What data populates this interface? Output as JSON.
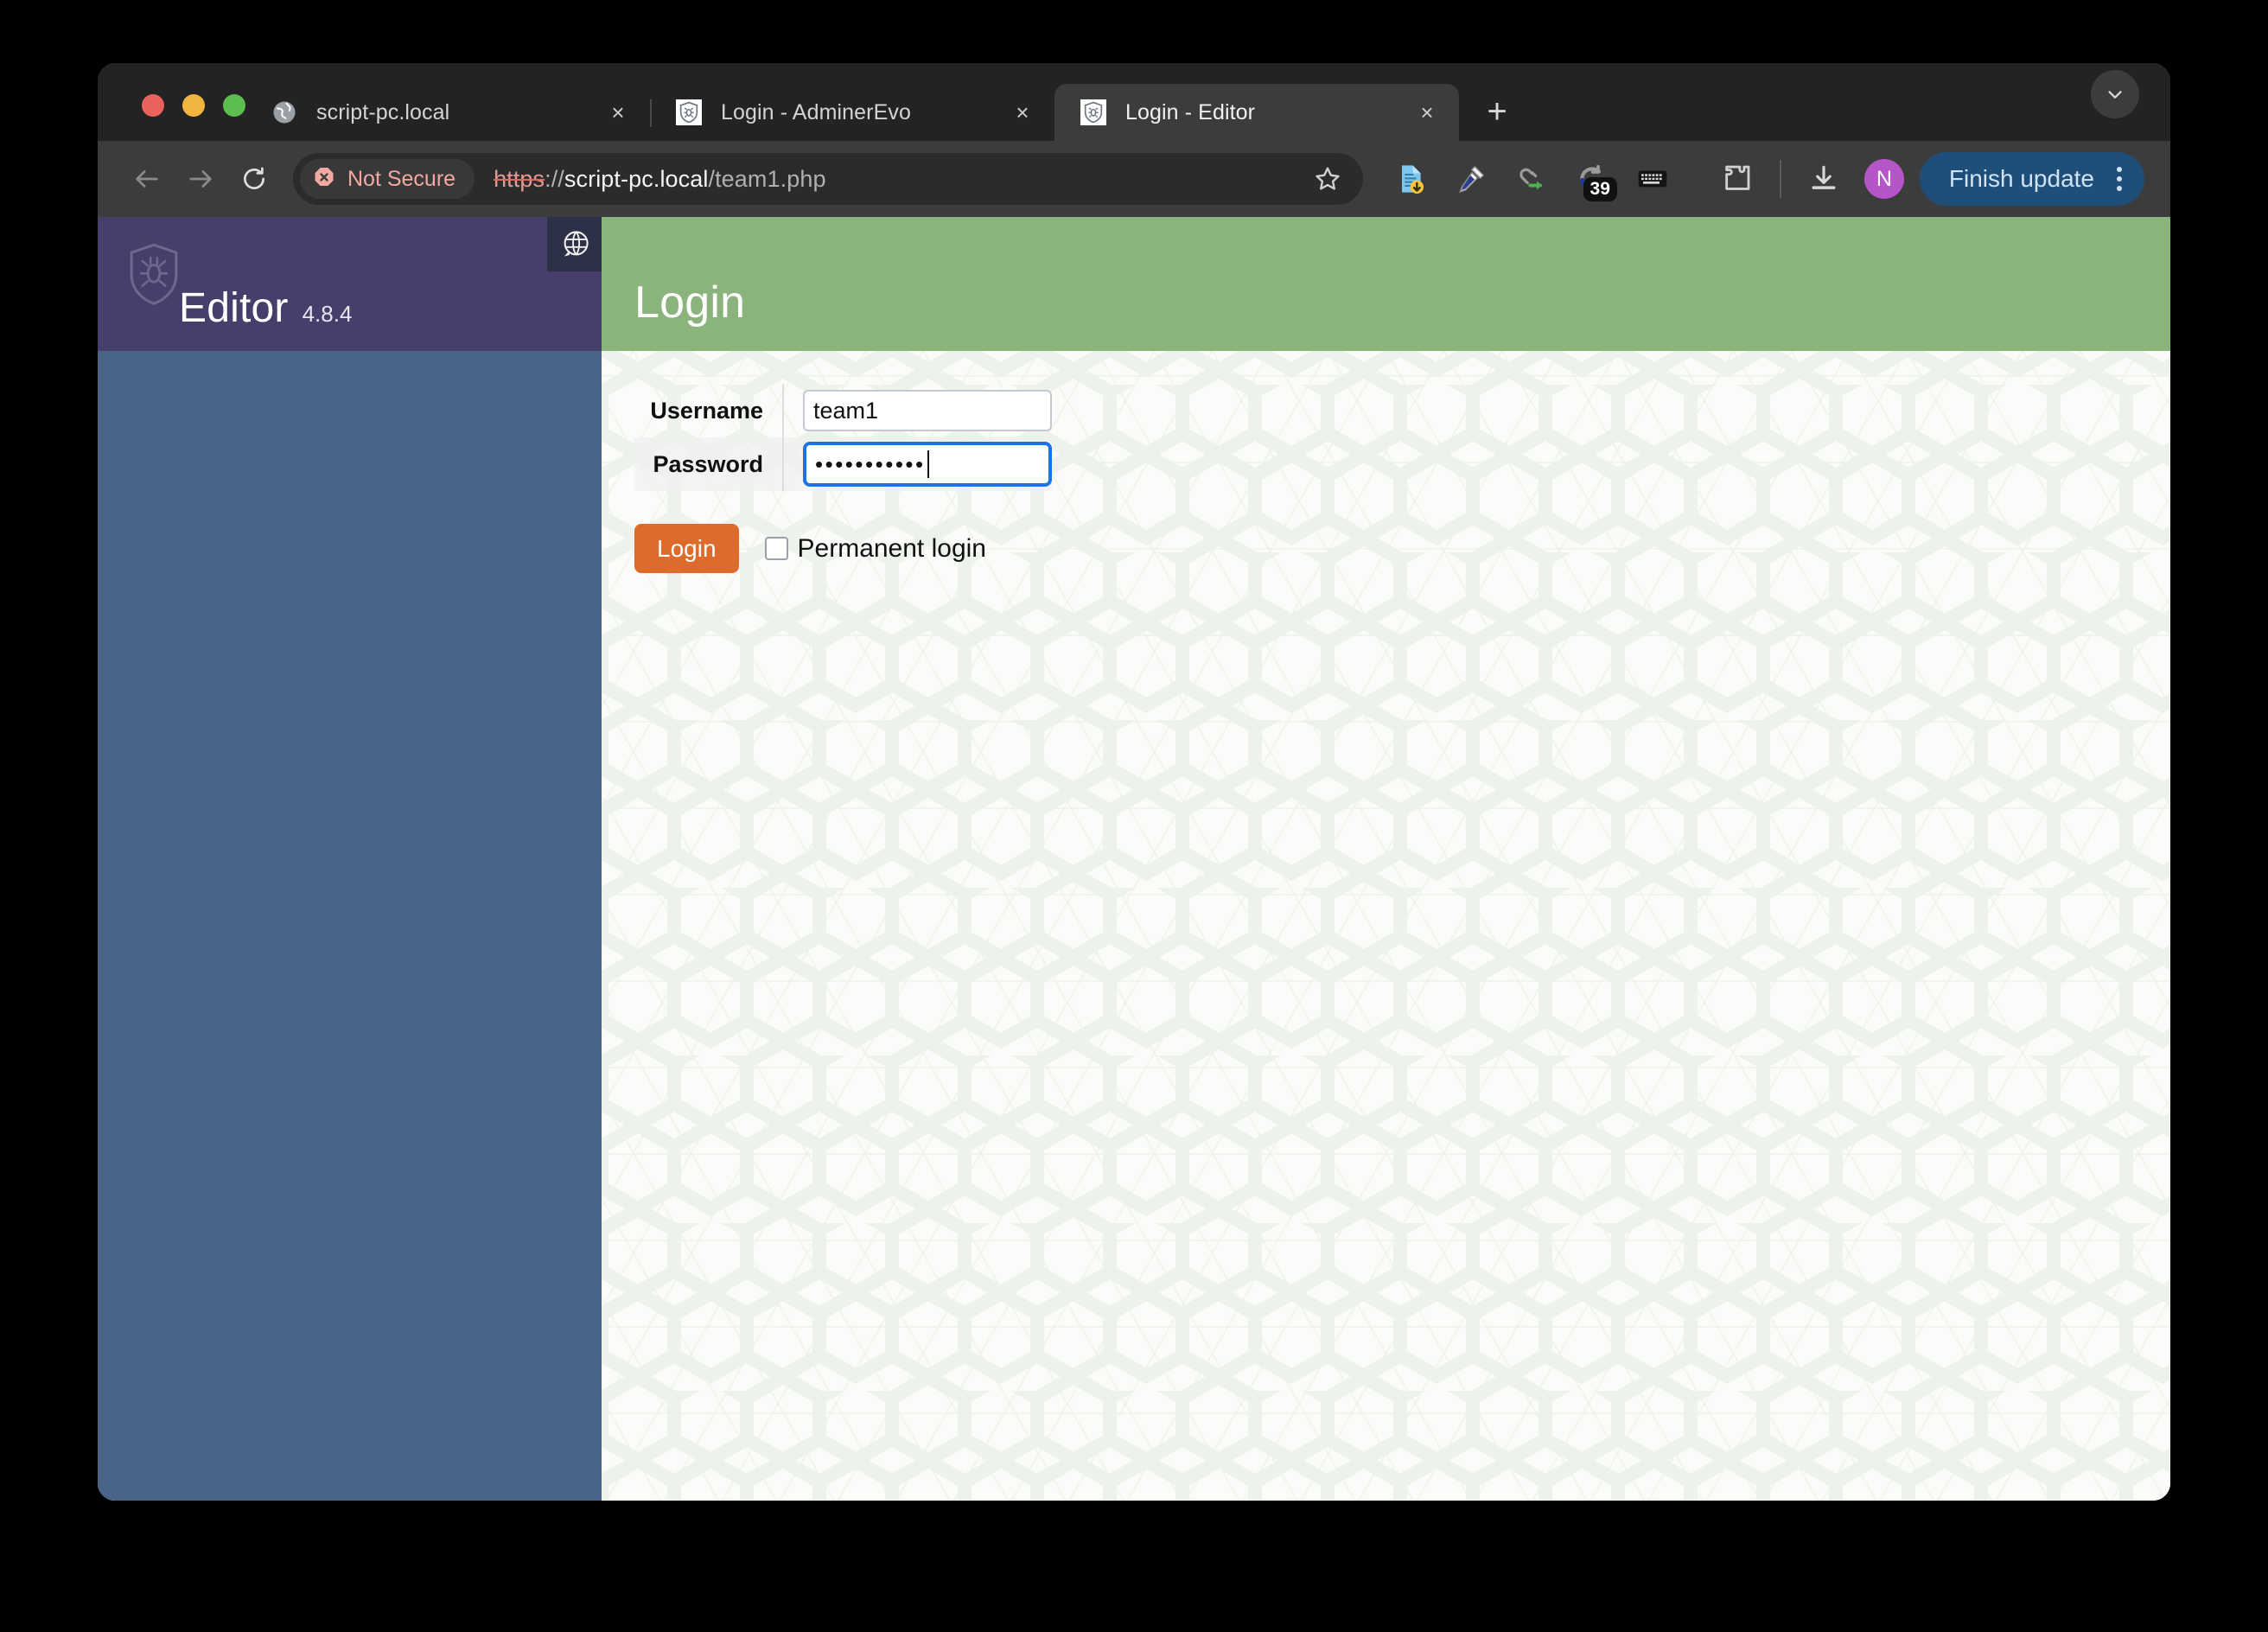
{
  "window": {
    "traffic_lights": [
      "close",
      "minimize",
      "zoom"
    ],
    "colors": {
      "traffic_red": "#e8635c",
      "traffic_yellow": "#f0b53f",
      "traffic_green": "#5cbe4e",
      "tabstrip_bg": "#232323",
      "toolbar_bg": "#3c3c3c",
      "active_tab_bg": "#3c3c3c"
    }
  },
  "tabs": [
    {
      "title": "script-pc.local",
      "favicon": "globe-icon",
      "active": false,
      "close_label": "×"
    },
    {
      "title": "Login - AdminerEvo",
      "favicon": "shield-bug-icon",
      "active": false,
      "close_label": "×"
    },
    {
      "title": "Login - Editor",
      "favicon": "shield-bug-icon",
      "active": true,
      "close_label": "×"
    }
  ],
  "tabstrip": {
    "new_tab_label": "+",
    "tab_list_icon": "chevron-down-icon"
  },
  "toolbar": {
    "back_icon": "arrow-left-icon",
    "forward_icon": "arrow-right-icon",
    "reload_icon": "reload-icon",
    "security": {
      "label": "Not Secure",
      "icon": "not-secure-icon",
      "color": "#f2a9a1"
    },
    "url": {
      "scheme": "https",
      "separator": "://",
      "host": "script-pc.local",
      "path": "/team1.php",
      "full": "https://script-pc.local/team1.php"
    },
    "bookmark_icon": "star-icon",
    "extensions": [
      {
        "name": "document-download-icon"
      },
      {
        "name": "eyedropper-icon"
      },
      {
        "name": "link-share-icon"
      },
      {
        "name": "sync-icon",
        "badge": "39"
      },
      {
        "name": "keyboard-icon"
      },
      {
        "name": "puzzle-piece-icon"
      }
    ],
    "downloads_icon": "download-icon",
    "profile": {
      "initial": "N",
      "color": "#b455c8"
    },
    "update": {
      "label": "Finish update",
      "menu_icon": "kebab-menu-icon",
      "color": "#1f4e79"
    }
  },
  "sidebar": {
    "brand_name": "Editor",
    "version": "4.8.4",
    "logo_icon": "shield-bug-logo",
    "language_icon": "globe-speech-icon",
    "header_color": "#463f6b",
    "body_color": "#4a6389"
  },
  "page": {
    "header_title": "Login",
    "header_color": "#8ab47b",
    "form": {
      "fields": [
        {
          "label": "Username",
          "value": "team1",
          "type": "text",
          "focused": false
        },
        {
          "label": "Password",
          "value": "•••••••••••",
          "type": "password",
          "focused": true
        }
      ],
      "submit_label": "Login",
      "submit_color": "#dd6c2c",
      "permanent_login": {
        "label": "Permanent login",
        "checked": false
      }
    }
  }
}
